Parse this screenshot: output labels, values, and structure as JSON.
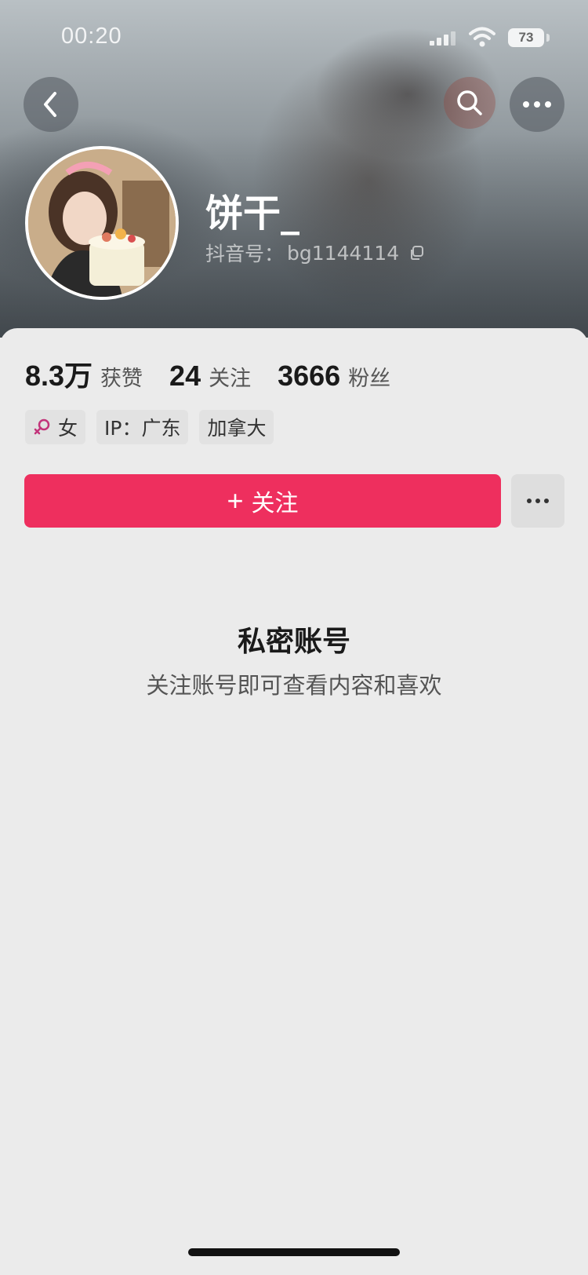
{
  "status_bar": {
    "time": "00:20",
    "battery": "73"
  },
  "profile": {
    "name": "饼干_",
    "handle_label": "抖音号：",
    "handle_value": "bg1144114"
  },
  "stats": [
    {
      "value": "8.3万",
      "label": "获赞"
    },
    {
      "value": "24",
      "label": "关注"
    },
    {
      "value": "3666",
      "label": "粉丝"
    }
  ],
  "tags": {
    "gender": "女",
    "ip": "IP：广东",
    "location": "加拿大"
  },
  "actions": {
    "follow_plus": "+",
    "follow_label": "关注"
  },
  "private": {
    "title": "私密账号",
    "subtitle": "关注账号即可查看内容和喜欢"
  },
  "colors": {
    "accent": "#ee2f5e",
    "background": "#ebebeb"
  },
  "icons": [
    "back-icon",
    "search-icon",
    "more-icon",
    "copy-icon",
    "female-icon",
    "signal-icon",
    "wifi-icon",
    "battery-icon"
  ]
}
